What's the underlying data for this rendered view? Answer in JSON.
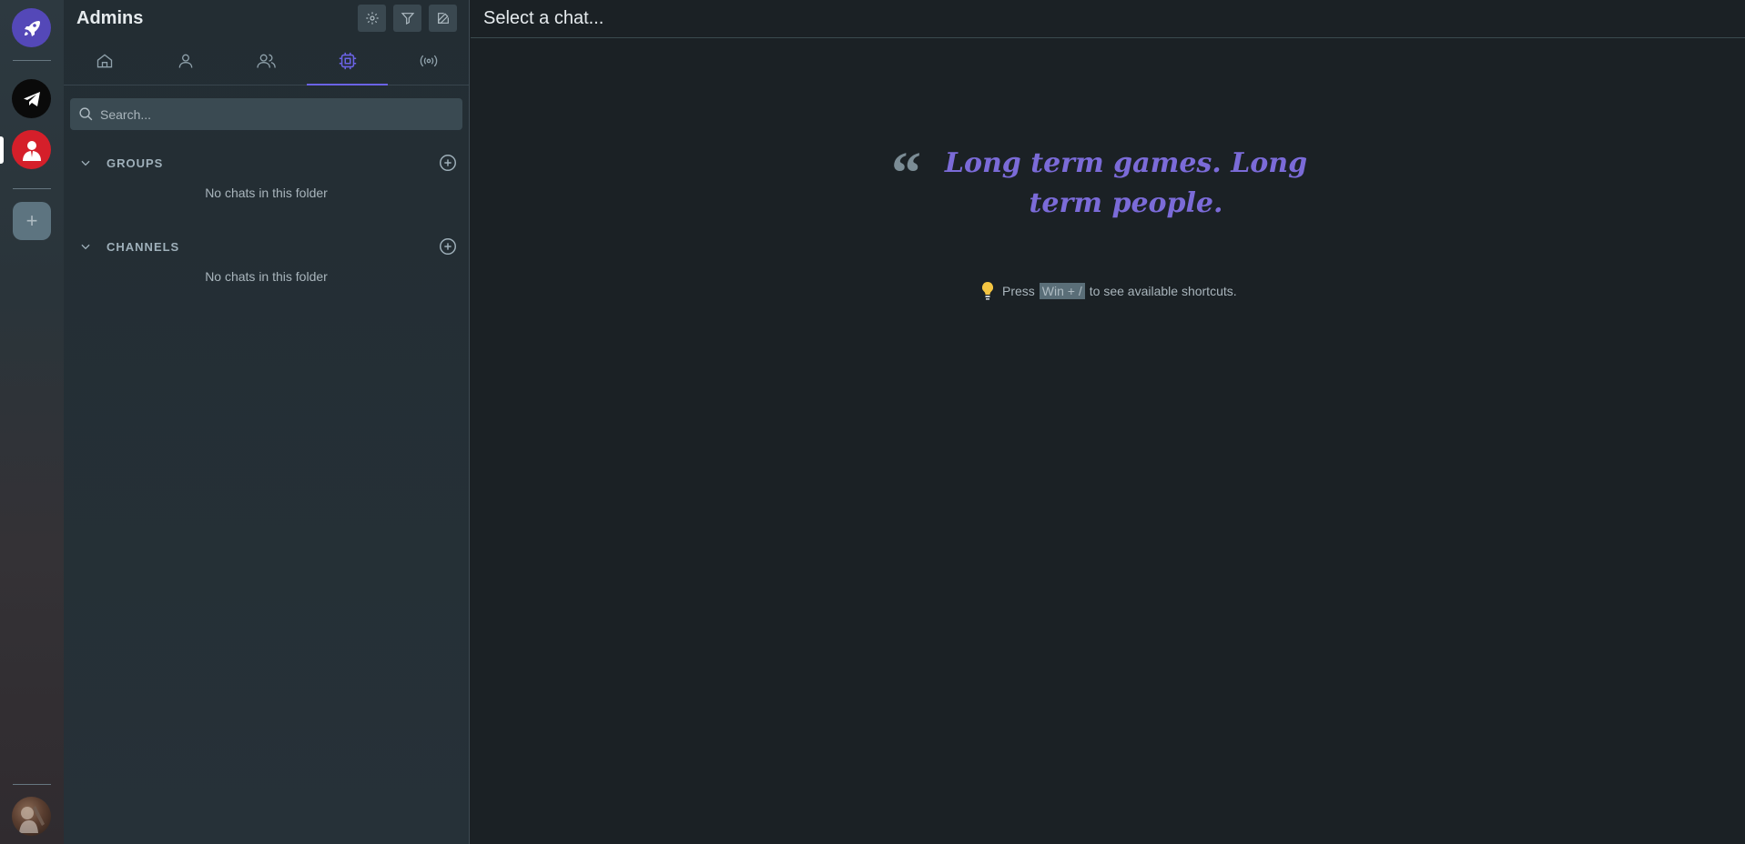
{
  "rail": {
    "apps": [
      {
        "name": "rocket-app",
        "color": "#5448b8"
      },
      {
        "name": "telegram-app",
        "color": "#0a0a0a"
      },
      {
        "name": "user-app",
        "color": "#d51f2a"
      }
    ],
    "add_label": "+"
  },
  "sidebar": {
    "title": "Admins",
    "header_buttons": [
      "gear-icon",
      "filter-icon",
      "edit-icon"
    ],
    "tabs": [
      {
        "icon": "home-icon"
      },
      {
        "icon": "person-icon"
      },
      {
        "icon": "people-icon"
      },
      {
        "icon": "chip-icon",
        "active": true
      },
      {
        "icon": "broadcast-icon"
      }
    ],
    "search": {
      "placeholder": "Search..."
    },
    "folders": [
      {
        "label": "GROUPS",
        "empty_text": "No chats in this folder"
      },
      {
        "label": "CHANNELS",
        "empty_text": "No chats in this folder"
      }
    ]
  },
  "main": {
    "title": "Select a chat...",
    "quote": "Long term games. Long term people.",
    "hint": {
      "prefix": "Press",
      "shortcut": "Win + /",
      "suffix": "to see available shortcuts."
    }
  },
  "colors": {
    "accent": "#6b63e6",
    "quote": "#7b6bd8",
    "background": "#1b2125"
  }
}
